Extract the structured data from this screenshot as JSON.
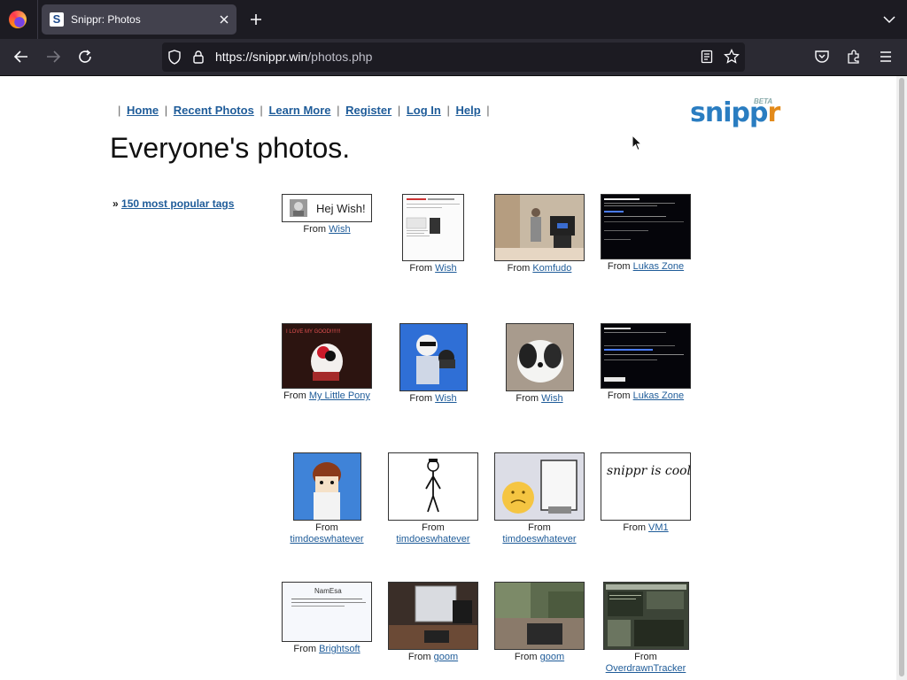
{
  "browser": {
    "tab_title": "Snippr: Photos",
    "tab_favicon_letter": "S",
    "url_host": "https://snippr.win",
    "url_path": "/photos.php"
  },
  "site": {
    "nav": [
      "Home",
      "Recent Photos",
      "Learn More",
      "Register",
      "Log In",
      "Help"
    ],
    "logo_main": "snipp",
    "logo_accent": "r",
    "logo_badge": "BETA",
    "page_title": "Everyone's photos.",
    "tags_bullet": "»",
    "tags_link": "150 most popular tags",
    "from_label": "From"
  },
  "photos": [
    {
      "source": "Wish",
      "thumb_text": "Hej Wish!"
    },
    {
      "source": "Wish"
    },
    {
      "source": "Komfudo"
    },
    {
      "source": "Lukas Zone"
    },
    {
      "source": "My Little Pony",
      "thumb_text": "I LOVE MY GOOD!!!!!!!"
    },
    {
      "source": "Wish"
    },
    {
      "source": "Wish"
    },
    {
      "source": "Lukas Zone"
    },
    {
      "source": "timdoeswhatever"
    },
    {
      "source": "timdoeswhatever"
    },
    {
      "source": "timdoeswhatever"
    },
    {
      "source": "VM1",
      "thumb_text": "snippr is cool -ks"
    },
    {
      "source": "Brightsoft",
      "thumb_text": "NamEsa"
    },
    {
      "source": "goom"
    },
    {
      "source": "goom"
    },
    {
      "source": "OverdrawnTracker"
    }
  ]
}
